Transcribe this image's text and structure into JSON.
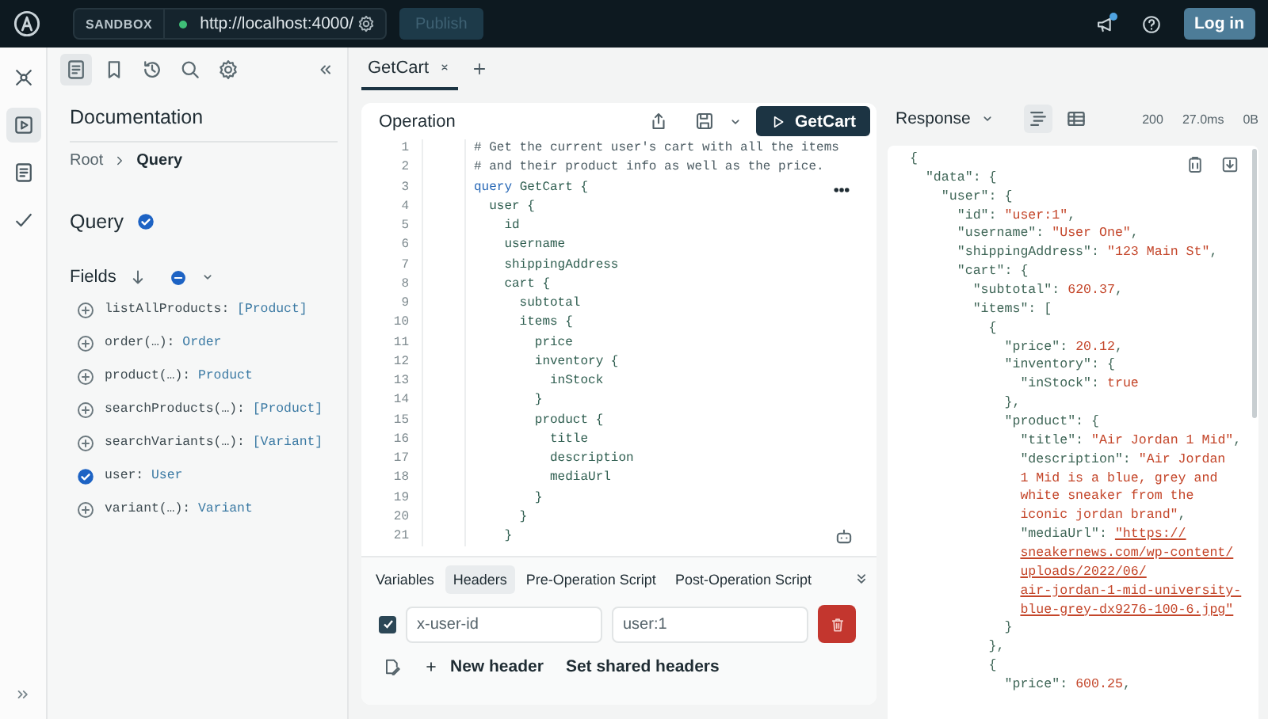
{
  "topbar": {
    "environment": "SANDBOX",
    "url": "http://localhost:4000/",
    "publish": {
      "label": "Publish",
      "disabled": true
    },
    "notification": true,
    "login": "Log in"
  },
  "rail": [
    {
      "kind": "graph",
      "selected": false
    },
    {
      "kind": "play",
      "selected": true
    },
    {
      "kind": "doc",
      "selected": false
    },
    {
      "kind": "check",
      "selected": false
    }
  ],
  "docs": {
    "tools": [
      {
        "kind": "doc",
        "selected": true
      },
      {
        "kind": "bookmark",
        "selected": false
      },
      {
        "kind": "history",
        "selected": false
      },
      {
        "kind": "search",
        "selected": false
      },
      {
        "kind": "settings",
        "selected": false
      }
    ],
    "title": "Documentation",
    "breadcrumb": [
      "Root",
      "Query"
    ],
    "type_name": "Query",
    "fields_label": "Fields",
    "fields": [
      {
        "name": "listAllProducts:",
        "type": "[Product]",
        "selected": false
      },
      {
        "name": "order(…):",
        "type": "Order",
        "selected": false
      },
      {
        "name": "product(…):",
        "type": "Product",
        "selected": false
      },
      {
        "name": "searchProducts(…):",
        "type": "[Product]",
        "selected": false
      },
      {
        "name": "searchVariants(…):",
        "type": "[Variant]",
        "selected": false
      },
      {
        "name": "user:",
        "type": "User",
        "selected": true
      },
      {
        "name": "variant(…):",
        "type": "Variant",
        "selected": false
      }
    ]
  },
  "tabs": [
    {
      "label": "GetCart",
      "selected": true
    }
  ],
  "operation": {
    "title": "Operation",
    "run_label": "GetCart",
    "lines": [
      {
        "number": "1",
        "tokens": [
          {
            "kind": "comment",
            "text": "# Get the current user's cart with all the items"
          }
        ]
      },
      {
        "number": "2",
        "tokens": [
          {
            "kind": "comment",
            "text": "# and their product info as well as the price."
          }
        ]
      },
      {
        "number": "3",
        "tokens": [
          {
            "kind": "keyword",
            "text": "query"
          },
          {
            "kind": "field",
            "text": " GetCart {"
          }
        ]
      },
      {
        "number": "4",
        "tokens": [
          {
            "kind": "field",
            "text": "  user {"
          }
        ]
      },
      {
        "number": "5",
        "tokens": [
          {
            "kind": "field",
            "text": "    id"
          }
        ]
      },
      {
        "number": "6",
        "tokens": [
          {
            "kind": "field",
            "text": "    username"
          }
        ]
      },
      {
        "number": "7",
        "tokens": [
          {
            "kind": "field",
            "text": "    shippingAddress"
          }
        ]
      },
      {
        "number": "8",
        "tokens": [
          {
            "kind": "field",
            "text": "    cart {"
          }
        ]
      },
      {
        "number": "9",
        "tokens": [
          {
            "kind": "field",
            "text": "      subtotal"
          }
        ]
      },
      {
        "number": "10",
        "tokens": [
          {
            "kind": "field",
            "text": "      items {"
          }
        ]
      },
      {
        "number": "11",
        "tokens": [
          {
            "kind": "field",
            "text": "        price"
          }
        ]
      },
      {
        "number": "12",
        "tokens": [
          {
            "kind": "field",
            "text": "        inventory {"
          }
        ]
      },
      {
        "number": "13",
        "tokens": [
          {
            "kind": "field",
            "text": "          inStock"
          }
        ]
      },
      {
        "number": "14",
        "tokens": [
          {
            "kind": "field",
            "text": "        }"
          }
        ]
      },
      {
        "number": "15",
        "tokens": [
          {
            "kind": "field",
            "text": "        product {"
          }
        ]
      },
      {
        "number": "16",
        "tokens": [
          {
            "kind": "field",
            "text": "          title"
          }
        ]
      },
      {
        "number": "17",
        "tokens": [
          {
            "kind": "field",
            "text": "          description"
          }
        ]
      },
      {
        "number": "18",
        "tokens": [
          {
            "kind": "field",
            "text": "          mediaUrl"
          }
        ]
      },
      {
        "number": "19",
        "tokens": [
          {
            "kind": "field",
            "text": "        }"
          }
        ]
      },
      {
        "number": "20",
        "tokens": [
          {
            "kind": "field",
            "text": "      }"
          }
        ]
      },
      {
        "number": "21",
        "tokens": [
          {
            "kind": "field",
            "text": "    }"
          }
        ]
      }
    ]
  },
  "request_tabs": [
    {
      "label": "Variables",
      "selected": false
    },
    {
      "label": "Headers",
      "selected": true
    },
    {
      "label": "Pre-Operation Script",
      "selected": false
    },
    {
      "label": "Post-Operation Script",
      "selected": false
    }
  ],
  "headers": [
    {
      "enabled": true,
      "key": "x-user-id",
      "value": "user:1"
    }
  ],
  "new_header": "New header",
  "shared_headers": "Set shared headers",
  "response": {
    "label": "Response",
    "views": [
      {
        "kind": "tree",
        "selected": true
      },
      {
        "kind": "table",
        "selected": false
      }
    ],
    "status": "200",
    "time": "27.0ms",
    "size": "0B",
    "lines": [
      [
        {
          "kind": "key",
          "text": "{"
        }
      ],
      [
        {
          "kind": "key",
          "text": "  \"data\": {"
        }
      ],
      [
        {
          "kind": "key",
          "text": "    \"user\": {"
        }
      ],
      [
        {
          "kind": "key",
          "text": "      \"id\": "
        },
        {
          "kind": "value",
          "text": "\"user:1\""
        },
        {
          "kind": "key",
          "text": ","
        }
      ],
      [
        {
          "kind": "key",
          "text": "      \"username\": "
        },
        {
          "kind": "value",
          "text": "\"User One\""
        },
        {
          "kind": "key",
          "text": ","
        }
      ],
      [
        {
          "kind": "key",
          "text": "      \"shippingAddress\": "
        },
        {
          "kind": "value",
          "text": "\"123 Main St\""
        },
        {
          "kind": "key",
          "text": ","
        }
      ],
      [
        {
          "kind": "key",
          "text": "      \"cart\": {"
        }
      ],
      [
        {
          "kind": "key",
          "text": "        \"subtotal\": "
        },
        {
          "kind": "value",
          "text": "620.37"
        },
        {
          "kind": "key",
          "text": ","
        }
      ],
      [
        {
          "kind": "key",
          "text": "        \"items\": ["
        }
      ],
      [
        {
          "kind": "key",
          "text": "          {"
        }
      ],
      [
        {
          "kind": "key",
          "text": "            \"price\": "
        },
        {
          "kind": "value",
          "text": "20.12"
        },
        {
          "kind": "key",
          "text": ","
        }
      ],
      [
        {
          "kind": "key",
          "text": "            \"inventory\": {"
        }
      ],
      [
        {
          "kind": "key",
          "text": "              \"inStock\": "
        },
        {
          "kind": "value",
          "text": "true"
        }
      ],
      [
        {
          "kind": "key",
          "text": "            },"
        }
      ],
      [
        {
          "kind": "key",
          "text": "            \"product\": {"
        }
      ],
      [
        {
          "kind": "key",
          "text": "              \"title\": "
        },
        {
          "kind": "value",
          "text": "\"Air Jordan 1 Mid\""
        },
        {
          "kind": "key",
          "text": ","
        }
      ],
      [
        {
          "kind": "key",
          "text": "              \"description\": "
        },
        {
          "kind": "value",
          "text": "\"Air Jordan"
        }
      ],
      [
        {
          "kind": "value",
          "text": "              1 Mid is a blue, grey and"
        }
      ],
      [
        {
          "kind": "value",
          "text": "              white sneaker from the"
        }
      ],
      [
        {
          "kind": "value",
          "text": "              iconic jordan brand\""
        },
        {
          "kind": "key",
          "text": ","
        }
      ],
      [
        {
          "kind": "key",
          "text": "              \"mediaUrl\": "
        },
        {
          "kind": "link",
          "text": "\"https://"
        }
      ],
      [
        {
          "kind": "wrapped_link",
          "text": "sneakernews.com/wp-content/"
        }
      ],
      [
        {
          "kind": "wrapped_link",
          "text": "uploads/2022/06/"
        }
      ],
      [
        {
          "kind": "wrapped_link",
          "text": "air-jordan-1-mid-university-"
        }
      ],
      [
        {
          "kind": "wrapped_link",
          "text": "blue-grey-dx9276-100-6.jpg\""
        }
      ],
      [
        {
          "kind": "key",
          "text": "            }"
        }
      ],
      [
        {
          "kind": "key",
          "text": "          },"
        }
      ],
      [
        {
          "kind": "key",
          "text": "          {"
        }
      ],
      [
        {
          "kind": "key",
          "text": "            \"price\": "
        },
        {
          "kind": "value",
          "text": "600.25"
        },
        {
          "kind": "key",
          "text": ","
        }
      ]
    ]
  }
}
